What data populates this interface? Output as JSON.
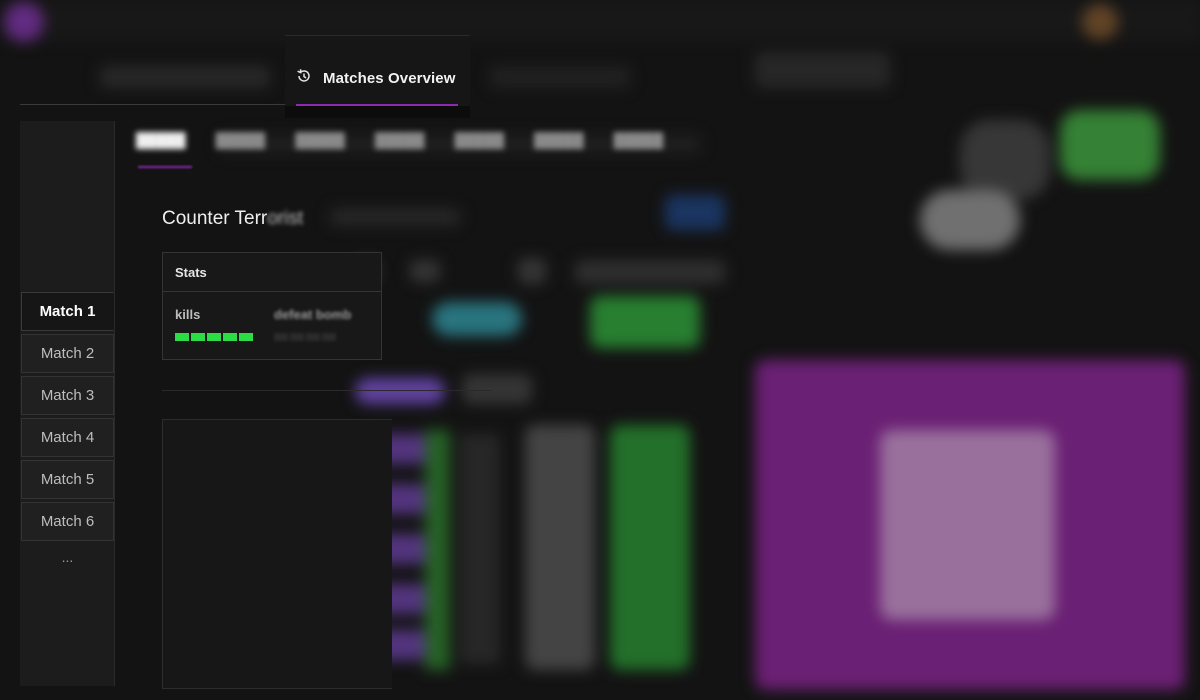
{
  "tabs": {
    "overview_label": "Matches Overview",
    "overview_icon": "history-clock-icon"
  },
  "matches": {
    "items": [
      "Match 1",
      "Match 2",
      "Match 3",
      "Match 4",
      "Match 5",
      "Match 6"
    ],
    "active_index": 0,
    "more_label": "..."
  },
  "team": {
    "title_prefix": "Counter Terr",
    "title_suffix": "orist"
  },
  "stats": {
    "header": "Stats",
    "kills_label": "kills",
    "kills_pips": 5,
    "defeat_label": "defeat bomb"
  },
  "colors": {
    "accent": "#8a2bb0",
    "kill_green": "#2bdc45"
  }
}
